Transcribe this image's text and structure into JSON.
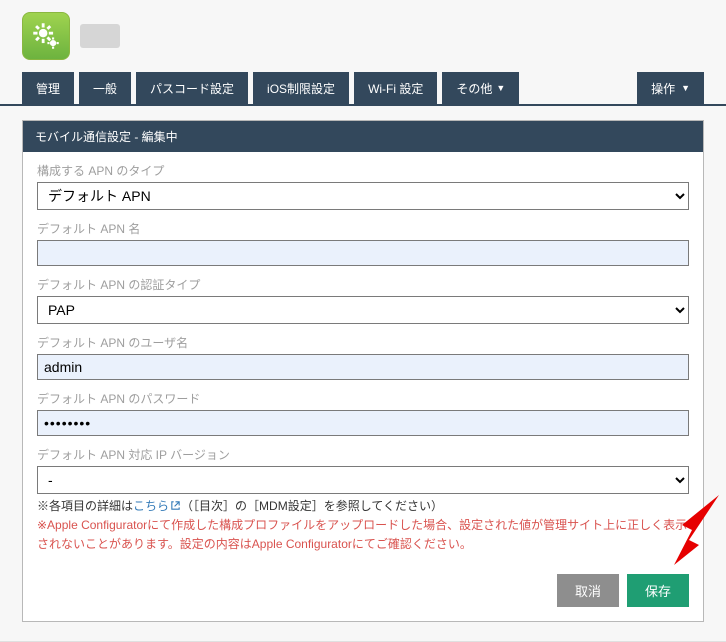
{
  "header": {
    "icon_name": "gear-app-icon"
  },
  "tabs": [
    "管理",
    "一般",
    "パスコード設定",
    "iOS制限設定",
    "Wi-Fi 設定",
    "その他"
  ],
  "ops_button": "操作",
  "panel": {
    "title": "モバイル通信設定 - 編集中",
    "fields": {
      "apn_type_label": "構成する APN のタイプ",
      "apn_type_value": "デフォルト APN",
      "apn_name_label": "デフォルト APN 名",
      "apn_name_value": "",
      "auth_type_label": "デフォルト APN の認証タイプ",
      "auth_type_value": "PAP",
      "user_label": "デフォルト APN のユーザ名",
      "user_value": "admin",
      "pw_label": "デフォルト APN のパスワード",
      "pw_value": "••••••••",
      "ipver_label": "デフォルト APN 対応 IP バージョン",
      "ipver_value": "-"
    },
    "note_prefix": "※各項目の詳細は",
    "note_link": "こちら",
    "note_suffix": "（［目次］の［MDM設定］を参照してください）",
    "warn": "※Apple Configuratorにて作成した構成プロファイルをアップロードした場合、設定された値が管理サイト上に正しく表示されないことがあります。設定の内容はApple Configuratorにてご確認ください。",
    "buttons": {
      "cancel": "取消",
      "save": "保存"
    }
  }
}
